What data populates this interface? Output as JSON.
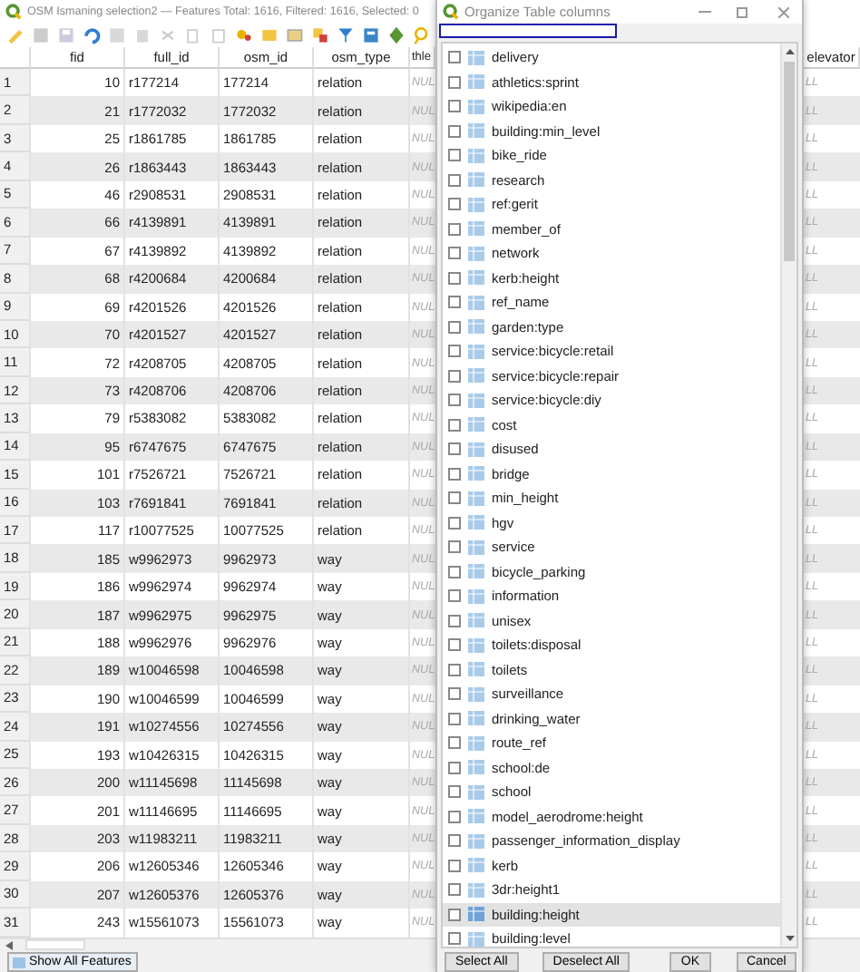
{
  "window": {
    "title": "OSM Ismaning selection2 — Features Total: 1616, Filtered: 1616, Selected: 0"
  },
  "table": {
    "columns": [
      "",
      "fid",
      "full_id",
      "osm_id",
      "osm_type",
      "thle",
      "elevator"
    ],
    "rows": [
      [
        "1",
        "10",
        "r177214",
        "177214",
        "relation",
        "NUL",
        "LL"
      ],
      [
        "2",
        "21",
        "r1772032",
        "1772032",
        "relation",
        "NUL",
        "LL"
      ],
      [
        "3",
        "25",
        "r1861785",
        "1861785",
        "relation",
        "NUL",
        "LL"
      ],
      [
        "4",
        "26",
        "r1863443",
        "1863443",
        "relation",
        "NUL",
        "LL"
      ],
      [
        "5",
        "46",
        "r2908531",
        "2908531",
        "relation",
        "NUL",
        "LL"
      ],
      [
        "6",
        "66",
        "r4139891",
        "4139891",
        "relation",
        "NUL",
        "LL"
      ],
      [
        "7",
        "67",
        "r4139892",
        "4139892",
        "relation",
        "NUL",
        "LL"
      ],
      [
        "8",
        "68",
        "r4200684",
        "4200684",
        "relation",
        "NUL",
        "LL"
      ],
      [
        "9",
        "69",
        "r4201526",
        "4201526",
        "relation",
        "NUL",
        "LL"
      ],
      [
        "10",
        "70",
        "r4201527",
        "4201527",
        "relation",
        "NUL",
        "LL"
      ],
      [
        "11",
        "72",
        "r4208705",
        "4208705",
        "relation",
        "NUL",
        "LL"
      ],
      [
        "12",
        "73",
        "r4208706",
        "4208706",
        "relation",
        "NUL",
        "LL"
      ],
      [
        "13",
        "79",
        "r5383082",
        "5383082",
        "relation",
        "NUL",
        "LL"
      ],
      [
        "14",
        "95",
        "r6747675",
        "6747675",
        "relation",
        "NUL",
        "LL"
      ],
      [
        "15",
        "101",
        "r7526721",
        "7526721",
        "relation",
        "NUL",
        "LL"
      ],
      [
        "16",
        "103",
        "r7691841",
        "7691841",
        "relation",
        "NUL",
        "LL"
      ],
      [
        "17",
        "117",
        "r10077525",
        "10077525",
        "relation",
        "NUL",
        "LL"
      ],
      [
        "18",
        "185",
        "w9962973",
        "9962973",
        "way",
        "NUL",
        "LL"
      ],
      [
        "19",
        "186",
        "w9962974",
        "9962974",
        "way",
        "NUL",
        "LL"
      ],
      [
        "20",
        "187",
        "w9962975",
        "9962975",
        "way",
        "NUL",
        "LL"
      ],
      [
        "21",
        "188",
        "w9962976",
        "9962976",
        "way",
        "NUL",
        "LL"
      ],
      [
        "22",
        "189",
        "w10046598",
        "10046598",
        "way",
        "NUL",
        "LL"
      ],
      [
        "23",
        "190",
        "w10046599",
        "10046599",
        "way",
        "NUL",
        "LL"
      ],
      [
        "24",
        "191",
        "w10274556",
        "10274556",
        "way",
        "NUL",
        "LL"
      ],
      [
        "25",
        "193",
        "w10426315",
        "10426315",
        "way",
        "NUL",
        "LL"
      ],
      [
        "26",
        "200",
        "w11145698",
        "11145698",
        "way",
        "NUL",
        "LL"
      ],
      [
        "27",
        "201",
        "w11146695",
        "11146695",
        "way",
        "NUL",
        "LL"
      ],
      [
        "28",
        "203",
        "w11983211",
        "11983211",
        "way",
        "NUL",
        "LL"
      ],
      [
        "29",
        "206",
        "w12605346",
        "12605346",
        "way",
        "NUL",
        "LL"
      ],
      [
        "30",
        "207",
        "w12605376",
        "12605376",
        "way",
        "NUL",
        "LL"
      ],
      [
        "31",
        "243",
        "w15561073",
        "15561073",
        "way",
        "NUL",
        "LL"
      ]
    ]
  },
  "bottom_button": "Show All Features",
  "dialog": {
    "title": "Organize Table columns",
    "items": [
      {
        "label": "delivery",
        "checked": false,
        "selected": false
      },
      {
        "label": "athletics:sprint",
        "checked": false,
        "selected": false
      },
      {
        "label": "wikipedia:en",
        "checked": false,
        "selected": false
      },
      {
        "label": "building:min_level",
        "checked": false,
        "selected": false
      },
      {
        "label": "bike_ride",
        "checked": false,
        "selected": false
      },
      {
        "label": "research",
        "checked": false,
        "selected": false
      },
      {
        "label": "ref:gerit",
        "checked": false,
        "selected": false
      },
      {
        "label": "member_of",
        "checked": false,
        "selected": false
      },
      {
        "label": "network",
        "checked": false,
        "selected": false
      },
      {
        "label": "kerb:height",
        "checked": false,
        "selected": false
      },
      {
        "label": "ref_name",
        "checked": false,
        "selected": false
      },
      {
        "label": "garden:type",
        "checked": false,
        "selected": false
      },
      {
        "label": "service:bicycle:retail",
        "checked": false,
        "selected": false
      },
      {
        "label": "service:bicycle:repair",
        "checked": false,
        "selected": false
      },
      {
        "label": "service:bicycle:diy",
        "checked": false,
        "selected": false
      },
      {
        "label": "cost",
        "checked": false,
        "selected": false
      },
      {
        "label": "disused",
        "checked": false,
        "selected": false
      },
      {
        "label": "bridge",
        "checked": false,
        "selected": false
      },
      {
        "label": "min_height",
        "checked": false,
        "selected": false
      },
      {
        "label": "hgv",
        "checked": false,
        "selected": false
      },
      {
        "label": "service",
        "checked": false,
        "selected": false
      },
      {
        "label": "bicycle_parking",
        "checked": false,
        "selected": false
      },
      {
        "label": "information",
        "checked": false,
        "selected": false
      },
      {
        "label": "unisex",
        "checked": false,
        "selected": false
      },
      {
        "label": "toilets:disposal",
        "checked": false,
        "selected": false
      },
      {
        "label": "toilets",
        "checked": false,
        "selected": false
      },
      {
        "label": "surveillance",
        "checked": false,
        "selected": false
      },
      {
        "label": "drinking_water",
        "checked": false,
        "selected": false
      },
      {
        "label": "route_ref",
        "checked": false,
        "selected": false
      },
      {
        "label": "school:de",
        "checked": false,
        "selected": false
      },
      {
        "label": "school",
        "checked": false,
        "selected": false
      },
      {
        "label": "model_aerodrome:height",
        "checked": false,
        "selected": false
      },
      {
        "label": "passenger_information_display",
        "checked": false,
        "selected": false
      },
      {
        "label": "kerb",
        "checked": false,
        "selected": false
      },
      {
        "label": "3dr:height1",
        "checked": false,
        "selected": false
      },
      {
        "label": "building:height",
        "checked": false,
        "selected": true
      },
      {
        "label": "building:level",
        "checked": false,
        "selected": false
      }
    ],
    "buttons": [
      "Select All",
      "Deselect All",
      "OK",
      "Cancel"
    ]
  }
}
